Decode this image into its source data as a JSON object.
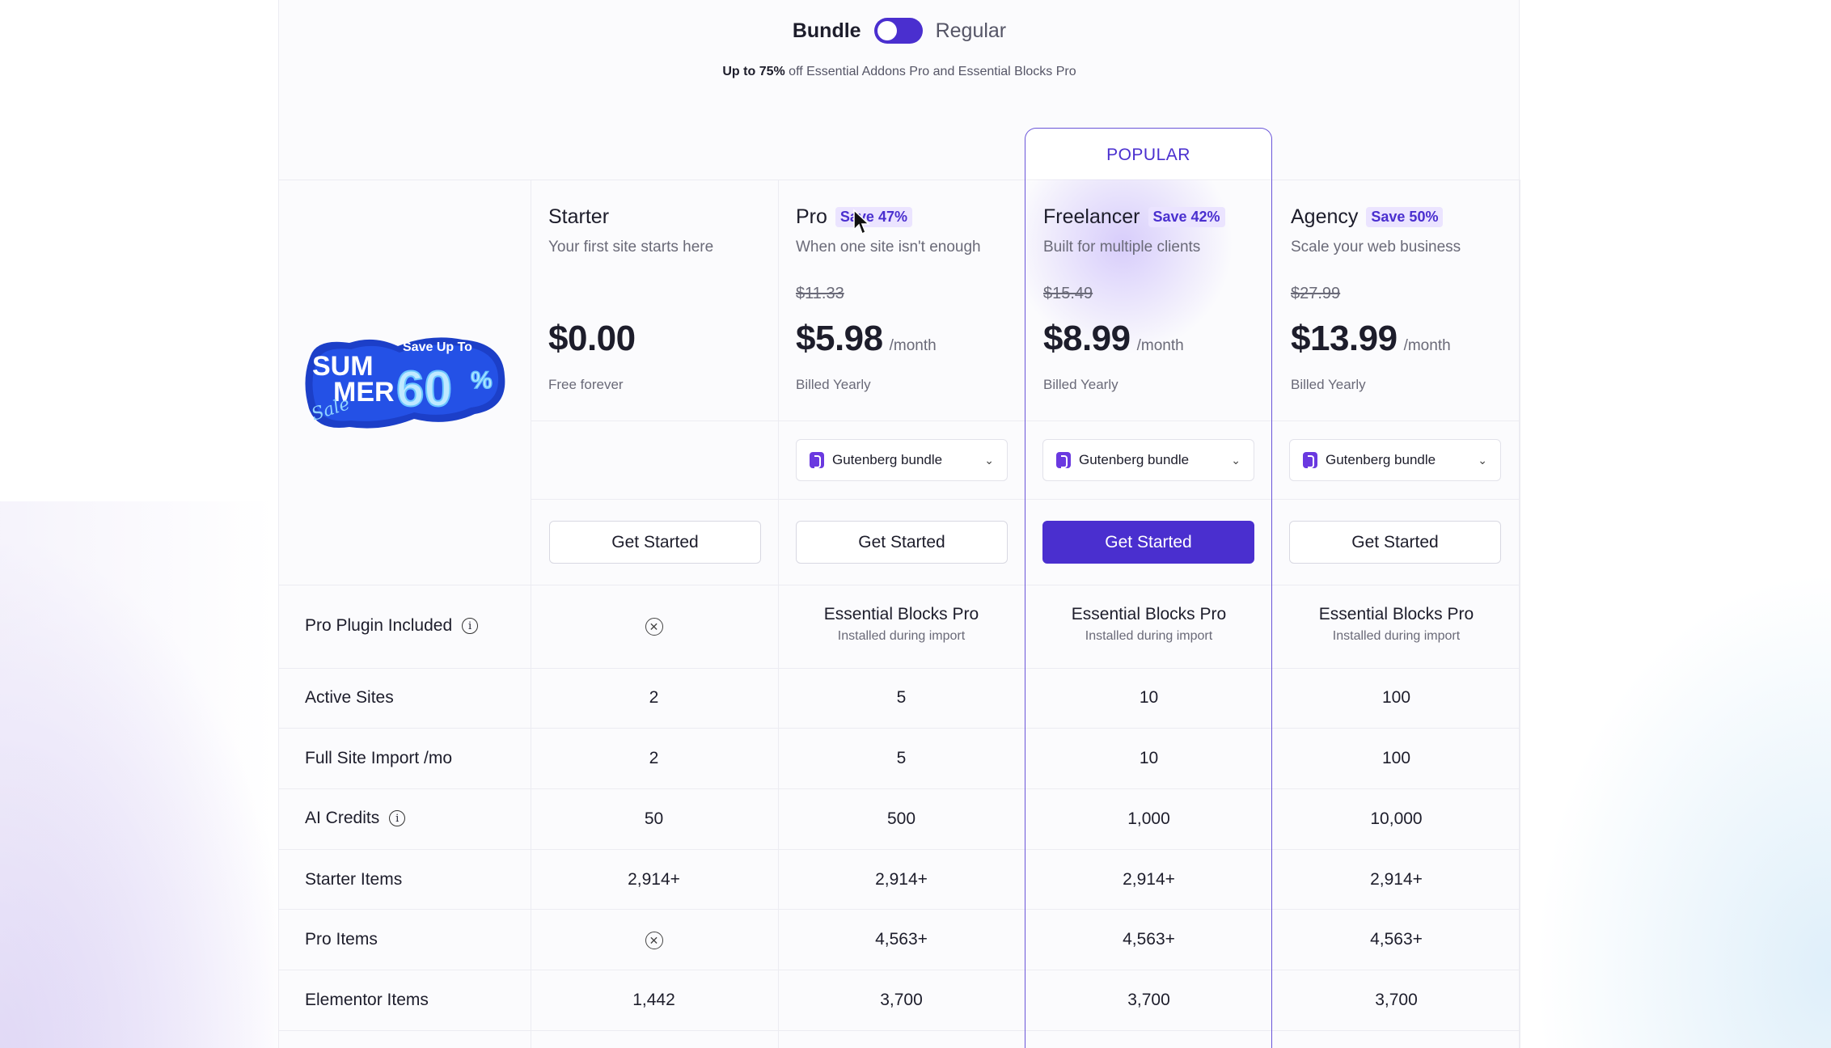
{
  "toggle": {
    "left_label": "Bundle",
    "right_label": "Regular"
  },
  "subline": {
    "bold": "Up to 75%",
    "rest": " off Essential Addons Pro and Essential Blocks Pro"
  },
  "popular_label": "POPULAR",
  "promo": {
    "line1": "SUM",
    "line2": "MER",
    "script": "Sale",
    "save": "Save Up To",
    "percent": "60",
    "pct_sign": "%"
  },
  "plans": [
    {
      "name": "Starter",
      "save": "",
      "desc": "Your first site starts here",
      "old_price": "",
      "price": "$0.00",
      "per": "",
      "billed": "Free forever",
      "dropdown": "",
      "button": "Get Started"
    },
    {
      "name": "Pro",
      "save": "Save 47%",
      "desc": "When one site isn't enough",
      "old_price": "$11.33",
      "price": "$5.98",
      "per": "/month",
      "billed": "Billed Yearly",
      "dropdown": "Gutenberg bundle",
      "button": "Get Started"
    },
    {
      "name": "Freelancer",
      "save": "Save 42%",
      "desc": "Built for multiple clients",
      "old_price": "$15.49",
      "price": "$8.99",
      "per": "/month",
      "billed": "Billed Yearly",
      "dropdown": "Gutenberg bundle",
      "button": "Get Started"
    },
    {
      "name": "Agency",
      "save": "Save 50%",
      "desc": "Scale your web business",
      "old_price": "$27.99",
      "price": "$13.99",
      "per": "/month",
      "billed": "Billed Yearly",
      "dropdown": "Gutenberg bundle",
      "button": "Get Started"
    }
  ],
  "features": [
    {
      "label": "Pro Plugin Included",
      "info": true,
      "values": [
        "",
        "Essential Blocks Pro",
        "Essential Blocks Pro",
        "Essential Blocks Pro"
      ],
      "subs": [
        "",
        "Installed during import",
        "Installed during import",
        "Installed during import"
      ]
    },
    {
      "label": "Active Sites",
      "values": [
        "2",
        "5",
        "10",
        "100"
      ]
    },
    {
      "label": "Full Site Import /mo",
      "values": [
        "2",
        "5",
        "10",
        "100"
      ]
    },
    {
      "label": "AI Credits",
      "info": true,
      "values": [
        "50",
        "500",
        "1,000",
        "10,000"
      ]
    },
    {
      "label": "Starter Items",
      "values": [
        "2,914+",
        "2,914+",
        "2,914+",
        "2,914+"
      ]
    },
    {
      "label": "Pro Items",
      "values": [
        "",
        "4,563+",
        "4,563+",
        "4,563+"
      ]
    },
    {
      "label": "Elementor Items",
      "values": [
        "1,442",
        "3,700",
        "3,700",
        "3,700"
      ]
    }
  ],
  "colors": {
    "accent": "#4a2fcf",
    "badge_bg": "#ebe4ff"
  }
}
